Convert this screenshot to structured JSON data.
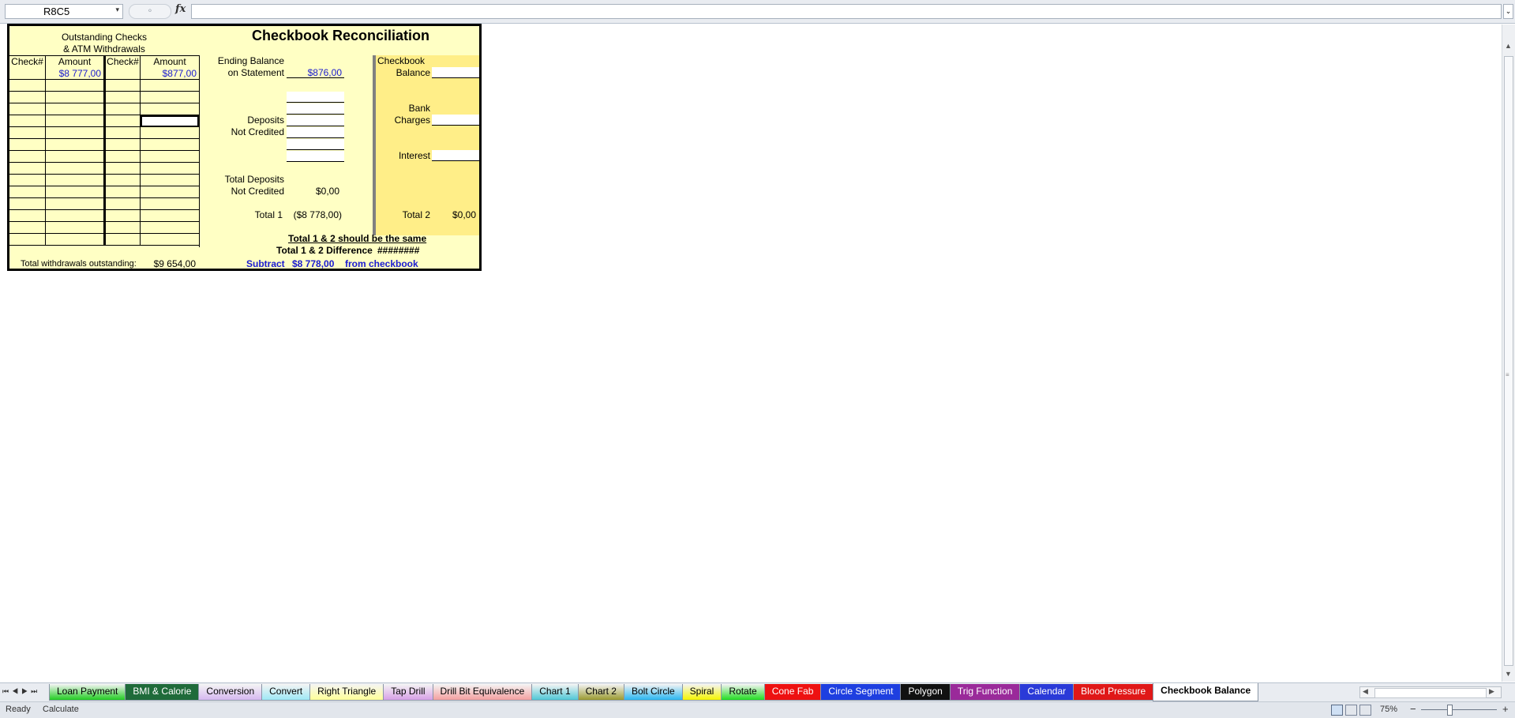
{
  "formula_bar": {
    "name_box": "R8C5",
    "dropdown_glyph": "▾",
    "cancel_glyph": "⚬",
    "fx_label": "fx",
    "formula": "",
    "expand_glyph": "⌄"
  },
  "sheet": {
    "title": "Checkbook Reconciliation",
    "outstanding": {
      "heading_line1": "Outstanding Checks",
      "heading_line2": "& ATM Withdrawals",
      "col_check1": "Check#",
      "col_amount1": "Amount",
      "col_check2": "Check#",
      "col_amount2": "Amount",
      "first_row_amount1": "$8 777,00",
      "first_row_amount2": "$877,00",
      "total_label": "Total withdrawals outstanding:",
      "total_value": "$9 654,00"
    },
    "statement": {
      "ending_balance_line1": "Ending Balance",
      "ending_balance_line2": "on Statement",
      "ending_balance_value": "$876,00",
      "deposits_line1": "Deposits",
      "deposits_line2": "Not Credited",
      "total_deposits_line1": "Total Deposits",
      "total_deposits_line2": "Not Credited",
      "total_deposits_value": "$0,00",
      "total1_label": "Total 1",
      "total1_value": "($8 778,00)"
    },
    "checkbook": {
      "balance_line1": "Checkbook",
      "balance_line2": "Balance",
      "bank_line1": "Bank",
      "bank_line2": "Charges",
      "interest_label": "Interest",
      "total2_label": "Total 2",
      "total2_value": "$0,00"
    },
    "summary": {
      "same_note": "Total 1 & 2 should be the same",
      "difference_label": "Total 1 & 2 Difference",
      "difference_value": "########",
      "subtract_label": "Subtract",
      "subtract_value": "$8 778,00",
      "subtract_suffix": "from checkbook"
    }
  },
  "tab_nav": {
    "first": "⏮",
    "prev": "◀",
    "next": "▶",
    "last": "⏭"
  },
  "tabs": [
    {
      "label": "Loan Payment",
      "color": "#22cc22"
    },
    {
      "label": "BMI & Calorie",
      "color": "#1f6b3a"
    },
    {
      "label": "Conversion",
      "color": "#d6b8f0"
    },
    {
      "label": "Convert",
      "color": "#9ee8f5"
    },
    {
      "label": "Right Triangle",
      "color": "#ffff99"
    },
    {
      "label": "Tap Drill",
      "color": "#d7a0e6"
    },
    {
      "label": "Drill Bit Equivalence",
      "color": "#f4a0a0"
    },
    {
      "label": "Chart 1",
      "color": "#4fc7d6"
    },
    {
      "label": "Chart 2",
      "color": "#9a9a30"
    },
    {
      "label": "Bolt Circle",
      "color": "#2ab6f0"
    },
    {
      "label": "Spiral",
      "color": "#f5f500"
    },
    {
      "label": "Rotate",
      "color": "#22dd22"
    },
    {
      "label": "Cone Fab",
      "color": "#ee1111"
    },
    {
      "label": "Circle Segment",
      "color": "#1e3fe0"
    },
    {
      "label": "Polygon",
      "color": "#111111"
    },
    {
      "label": "Trig Function",
      "color": "#9a2a9a"
    },
    {
      "label": "Calendar",
      "color": "#2a3ad8"
    },
    {
      "label": "Blood Pressure",
      "color": "#e01818"
    },
    {
      "label": "Checkbook Balance",
      "color": "#ffffff",
      "active": true
    }
  ],
  "status_bar": {
    "ready": "Ready",
    "calculate": "Calculate",
    "zoom": "75%",
    "zoom_minus": "−",
    "zoom_plus": "+"
  }
}
